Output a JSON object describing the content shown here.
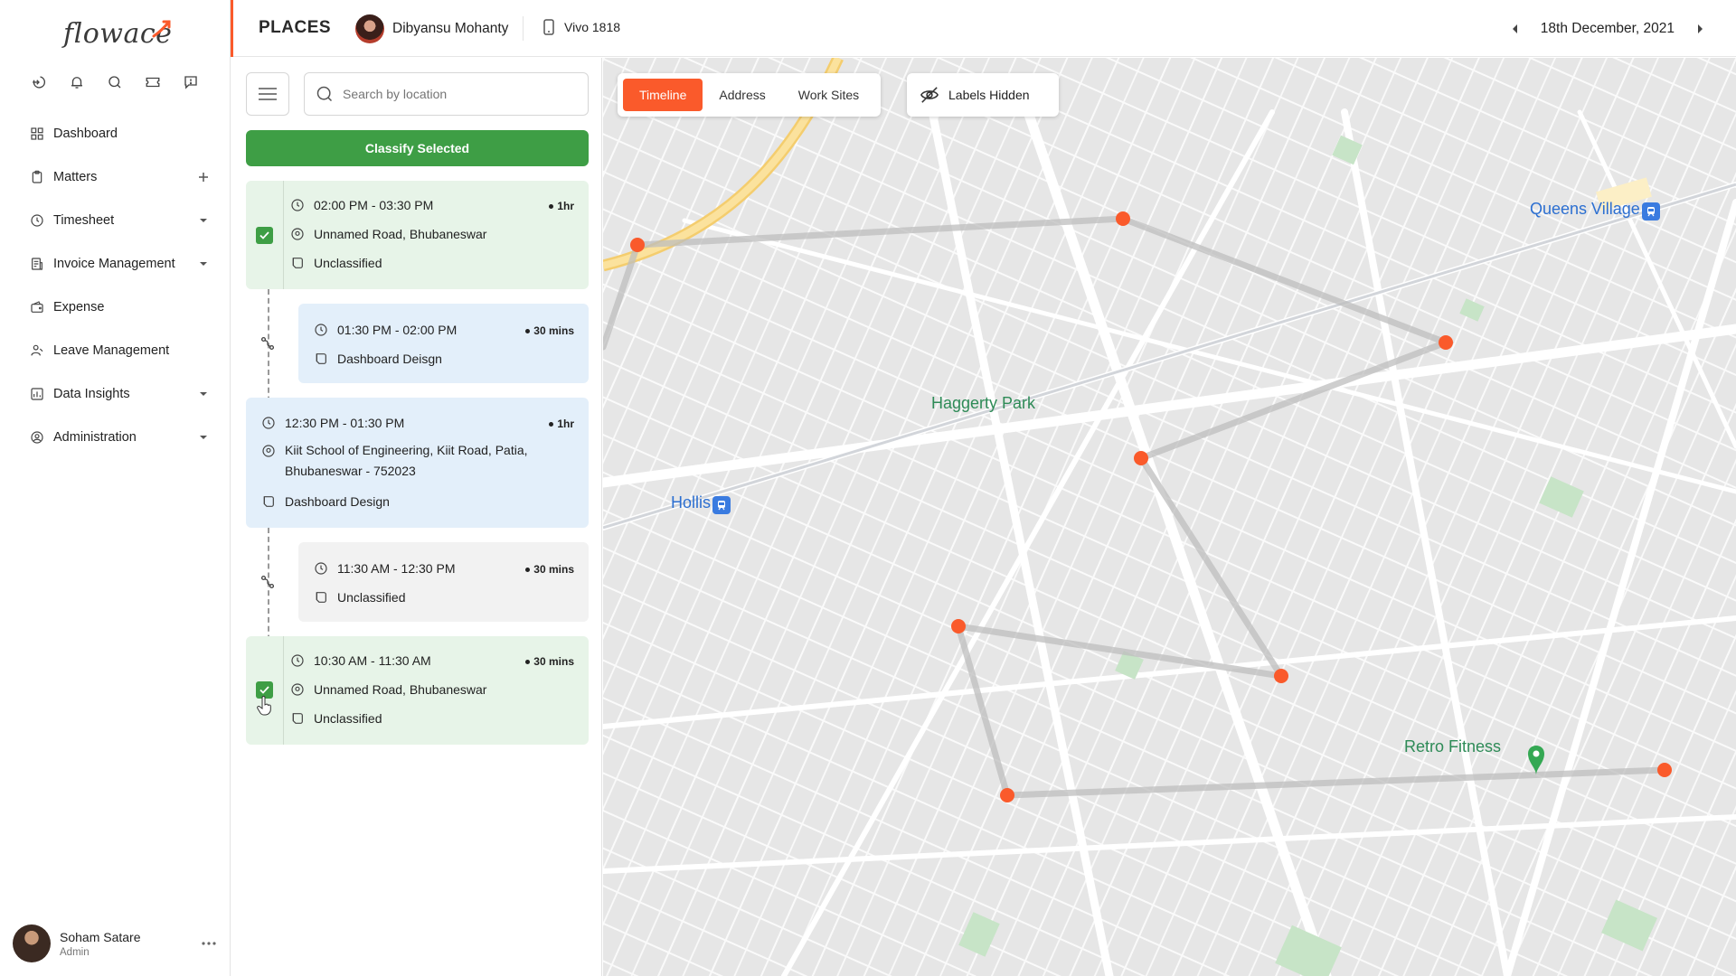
{
  "brand": {
    "logo_text": "flowace",
    "accent": "#fa5a2b",
    "green": "#3e9e45"
  },
  "sidebar": {
    "quick_icons": [
      "logout-icon",
      "bell-icon",
      "search-icon",
      "ticket-icon",
      "feedback-icon"
    ],
    "items": [
      {
        "label": "Dashboard",
        "icon": "grid-icon",
        "right": ""
      },
      {
        "label": "Matters",
        "icon": "clipboard-icon",
        "right": "plus"
      },
      {
        "label": "Timesheet",
        "icon": "clock-icon",
        "right": "caret"
      },
      {
        "label": "Invoice Management",
        "icon": "invoice-icon",
        "right": "caret"
      },
      {
        "label": "Expense",
        "icon": "wallet-icon",
        "right": ""
      },
      {
        "label": "Leave Management",
        "icon": "leave-icon",
        "right": ""
      },
      {
        "label": "Data Insights",
        "icon": "chart-icon",
        "right": "caret"
      },
      {
        "label": "Administration",
        "icon": "admin-icon",
        "right": "caret"
      }
    ],
    "user": {
      "name": "Soham Satare",
      "role": "Admin"
    }
  },
  "header": {
    "title": "PLACES",
    "member_name": "Dibyansu Mohanty",
    "device": "Vivo 1818",
    "date": "18th December, 2021"
  },
  "panel": {
    "search_placeholder": "Search by location",
    "classify_label": "Classify Selected",
    "entries": [
      {
        "time": "02:00 PM - 03:30 PM",
        "duration": "1hr",
        "location": "Unnamed Road, Bhubaneswar",
        "tag": "Unclassified",
        "checked": true,
        "kind": "place"
      },
      {
        "time": "01:30 PM - 02:00 PM",
        "duration": "30 mins",
        "tag": "Dashboard Deisgn",
        "kind": "travel"
      },
      {
        "time": "12:30 PM - 01:30 PM",
        "duration": "1hr",
        "location": "Kiit School of Engineering, Kiit Road, Patia, Bhubaneswar - 752023",
        "tag": "Dashboard Design",
        "checked": false,
        "kind": "place"
      },
      {
        "time": "11:30 AM - 12:30 PM",
        "duration": "30 mins",
        "tag": "Unclassified",
        "kind": "travel"
      },
      {
        "time": "10:30 AM - 11:30 AM",
        "duration": "30 mins",
        "location": "Unnamed Road, Bhubaneswar",
        "tag": "Unclassified",
        "checked": true,
        "kind": "place"
      }
    ]
  },
  "map": {
    "tabs": [
      "Timeline",
      "Address",
      "Work Sites"
    ],
    "active_tab": "Timeline",
    "labels_toggle": "Labels Hidden",
    "labels": {
      "queens_village": "Queens Village",
      "haggerty_park": "Haggerty Park",
      "hollis": "Hollis",
      "retro_fitness": "Retro Fitness"
    },
    "marker_color": "#fa5a2b"
  }
}
